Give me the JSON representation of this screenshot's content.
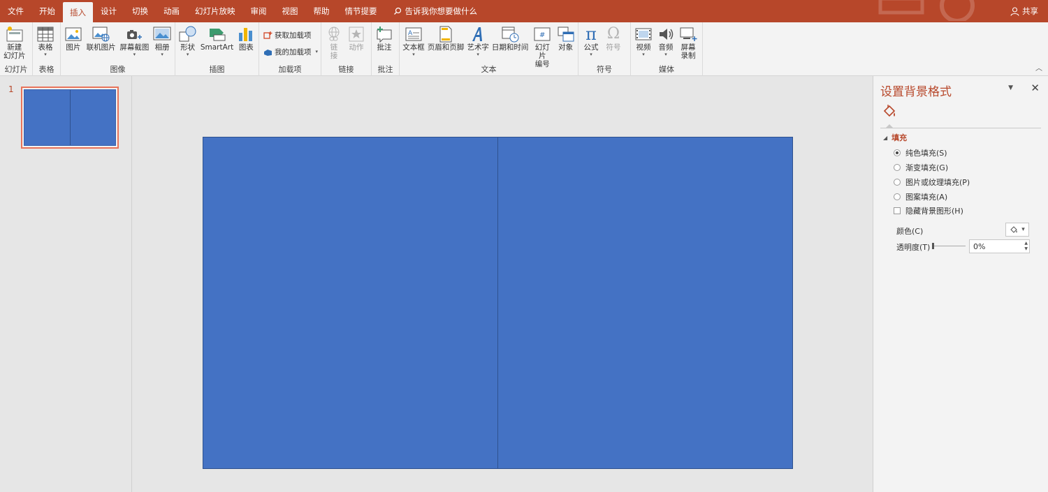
{
  "tabs": [
    {
      "label": "文件",
      "active": false
    },
    {
      "label": "开始",
      "active": false
    },
    {
      "label": "插入",
      "active": true
    },
    {
      "label": "设计",
      "active": false
    },
    {
      "label": "切换",
      "active": false
    },
    {
      "label": "动画",
      "active": false
    },
    {
      "label": "幻灯片放映",
      "active": false
    },
    {
      "label": "审阅",
      "active": false
    },
    {
      "label": "视图",
      "active": false
    },
    {
      "label": "帮助",
      "active": false
    },
    {
      "label": "情节提要",
      "active": false
    }
  ],
  "tell_me": "告诉我你想要做什么",
  "share": "共享",
  "ribbon": {
    "slides": {
      "label": "幻灯片",
      "new_slide": "新建\n幻灯片"
    },
    "tables": {
      "label": "表格",
      "table": "表格"
    },
    "images": {
      "label": "图像",
      "picture": "图片",
      "online_picture": "联机图片",
      "screenshot": "屏幕截图",
      "album": "相册"
    },
    "illustrations": {
      "label": "插图",
      "shapes": "形状",
      "smartart": "SmartArt",
      "chart": "图表"
    },
    "addins": {
      "label": "加载项",
      "get": "获取加载项",
      "my": "我的加载项"
    },
    "links": {
      "label": "链接",
      "link": "链\n接",
      "action": "动作"
    },
    "comments": {
      "label": "批注",
      "comment": "批注"
    },
    "text": {
      "label": "文本",
      "textbox": "文本框",
      "header_footer": "页眉和页脚",
      "wordart": "艺术字",
      "datetime": "日期和时间",
      "slide_number": "幻灯片\n编号",
      "object": "对象"
    },
    "symbols": {
      "label": "符号",
      "equation": "公式",
      "symbol": "符号"
    },
    "media": {
      "label": "媒体",
      "video": "视频",
      "audio": "音频",
      "screen_recording": "屏幕\n录制"
    }
  },
  "thumbnail": {
    "number": "1"
  },
  "pane": {
    "title": "设置背景格式",
    "section": "填充",
    "options": [
      {
        "label": "纯色填充(S)",
        "type": "radio",
        "selected": true
      },
      {
        "label": "渐变填充(G)",
        "type": "radio",
        "selected": false
      },
      {
        "label": "图片或纹理填充(P)",
        "type": "radio",
        "selected": false
      },
      {
        "label": "图案填充(A)",
        "type": "radio",
        "selected": false
      },
      {
        "label": "隐藏背景图形(H)",
        "type": "checkbox",
        "selected": false
      }
    ],
    "color_label": "颜色(C)",
    "transparency_label": "透明度(T)",
    "transparency_value": "0%"
  },
  "colors": {
    "accent": "#b7472a",
    "slide": "#4472c4"
  }
}
